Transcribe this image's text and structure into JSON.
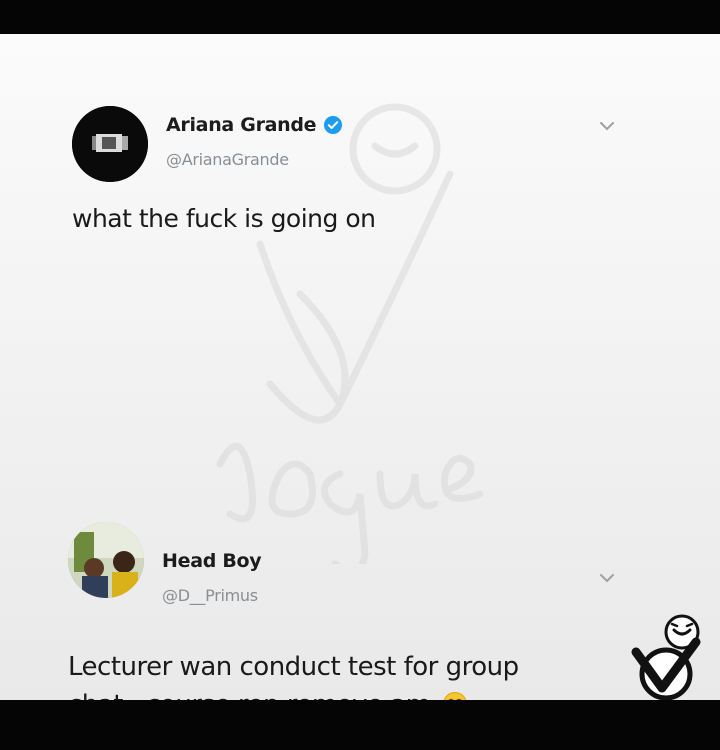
{
  "tweets": [
    {
      "display_name": "Ariana Grande",
      "handle": "@ArianaGrande",
      "verified": true,
      "text": "what the fuck is going on"
    },
    {
      "display_name": "Head Boy",
      "handle": "@D__Primus",
      "verified": false,
      "text": "Lecturer wan conduct test for group chat...course rep remove am",
      "emoji": "face-with-tears-of-joy"
    }
  ],
  "colors": {
    "verified_blue": "#1d9bf0",
    "name_text": "#1c1c1c",
    "handle_text": "#8a8f94",
    "background": "#f5f5f5",
    "frame": "#050505"
  }
}
